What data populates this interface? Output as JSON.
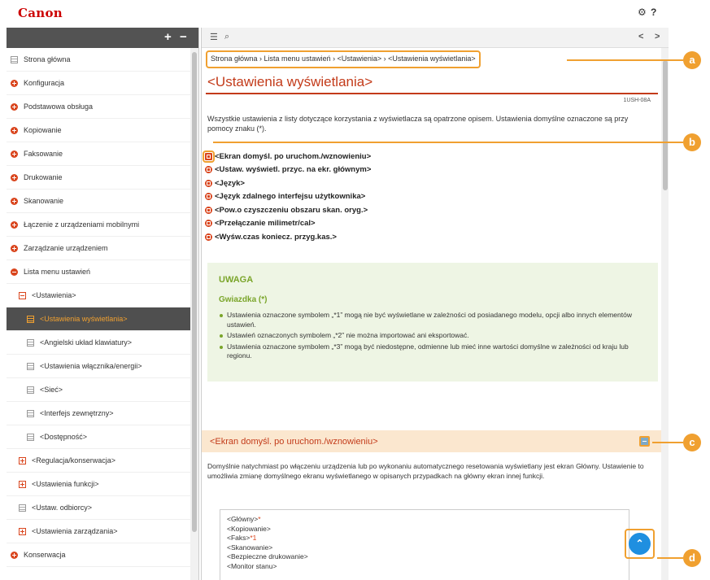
{
  "app": {
    "logo": "Canon",
    "settings_icon": "gear-icon",
    "help_label": "?"
  },
  "sidebar": {
    "expand_label": "+",
    "collapse_label": "−",
    "items": [
      {
        "label": "Strona główna",
        "icon": "doc-icon"
      },
      {
        "label": "Konfiguracja",
        "icon": "circle-plus-icon"
      },
      {
        "label": "Podstawowa obsługa",
        "icon": "circle-plus-icon"
      },
      {
        "label": "Kopiowanie",
        "icon": "circle-plus-icon"
      },
      {
        "label": "Faksowanie",
        "icon": "circle-plus-icon"
      },
      {
        "label": "Drukowanie",
        "icon": "circle-plus-icon"
      },
      {
        "label": "Skanowanie",
        "icon": "circle-plus-icon"
      },
      {
        "label": "Łączenie z urządzeniami mobilnymi",
        "icon": "circle-plus-icon"
      },
      {
        "label": "Zarządzanie urządzeniem",
        "icon": "circle-plus-icon"
      },
      {
        "label": "Lista menu ustawień",
        "icon": "circle-minus-icon"
      },
      {
        "label": "<Ustawienia>",
        "icon": "box-minus-icon"
      },
      {
        "label": "<Ustawienia wyświetlania>",
        "icon": "doc-icon",
        "active": true
      },
      {
        "label": "<Angielski układ klawiatury>",
        "icon": "doc-icon"
      },
      {
        "label": "<Ustawienia włącznika/energii>",
        "icon": "doc-icon"
      },
      {
        "label": "<Sieć>",
        "icon": "doc-icon"
      },
      {
        "label": "<Interfejs zewnętrzny>",
        "icon": "doc-icon"
      },
      {
        "label": "<Dostępność>",
        "icon": "doc-icon"
      },
      {
        "label": "<Regulacja/konserwacja>",
        "icon": "box-plus-icon"
      },
      {
        "label": "<Ustawienia funkcji>",
        "icon": "box-plus-icon"
      },
      {
        "label": "<Ustaw. odbiorcy>",
        "icon": "doc-icon"
      },
      {
        "label": "<Ustawienia zarządzania>",
        "icon": "box-plus-icon"
      },
      {
        "label": "Konserwacja",
        "icon": "circle-plus-icon"
      }
    ]
  },
  "toolbar": {
    "toc_icon": "list-icon",
    "search_icon": "search-icon",
    "prev_label": "<",
    "next_label": ">"
  },
  "breadcrumb": "Strona główna › Lista menu ustawień › <Ustawienia> › <Ustawienia wyświetlania>",
  "page": {
    "title": "<Ustawienia wyświetlania>",
    "doc_id": "1USH-08A",
    "intro": "Wszystkie ustawienia z listy dotyczące korzystania z wyświetlacza są opatrzone opisem. Ustawienia domyślne oznaczone są przy pomocy znaku (*).",
    "links": [
      "<Ekran domyśl. po uruchom./wznowieniu>",
      "<Ustaw. wyświetl. przyc. na ekr. głównym>",
      "<Język>",
      "<Język zdalnego interfejsu użytkownika>",
      "<Pow.o czyszczeniu obszaru skan. oryg.>",
      "<Przełączanie milimetr/cal>",
      "<Wyśw.czas koniecz. przyg.kas.>"
    ]
  },
  "note": {
    "title": "UWAGA",
    "subtitle": "Gwiazdka (*)",
    "items": [
      "Ustawienia oznaczone symbolem „*1” mogą nie być wyświetlane w zależności od posiadanego modelu, opcji albo innych elementów ustawień.",
      "Ustawień oznaczonych symbolem „*2” nie można importować ani eksportować.",
      "Ustawienia oznaczone symbolem „*3” mogą być niedostępne, odmienne lub mieć inne wartości domyślne w zależności od kraju lub regionu."
    ]
  },
  "section": {
    "title": "<Ekran domyśl. po uruchom./wznowieniu>",
    "collapse_icon": "collapse-icon",
    "text": "Domyślnie natychmiast po włączeniu urządzenia lub po wykonaniu automatycznego resetowania wyświetlany jest ekran Główny. Ustawienie to umożliwia zmianę domyślnego ekranu wyświetlanego w opisanych przypadkach na główny ekran innej funkcji.",
    "options": [
      {
        "label": "<Główny>",
        "mark": "*"
      },
      {
        "label": "<Kopiowanie>",
        "mark": ""
      },
      {
        "label": "<Faks>",
        "mark": "*1"
      },
      {
        "label": "<Skanowanie>",
        "mark": ""
      },
      {
        "label": "<Bezpieczne drukowanie>",
        "mark": ""
      },
      {
        "label": "<Monitor stanu>",
        "mark": ""
      }
    ]
  },
  "back_to_top_icon": "chevron-up-icon",
  "callouts": [
    "a",
    "b",
    "c",
    "d"
  ],
  "colors": {
    "accent": "#f0a030",
    "brand": "#cc0000",
    "title": "#c33b1a",
    "note_bg": "#eef5e4",
    "fab": "#1f8fe0"
  }
}
